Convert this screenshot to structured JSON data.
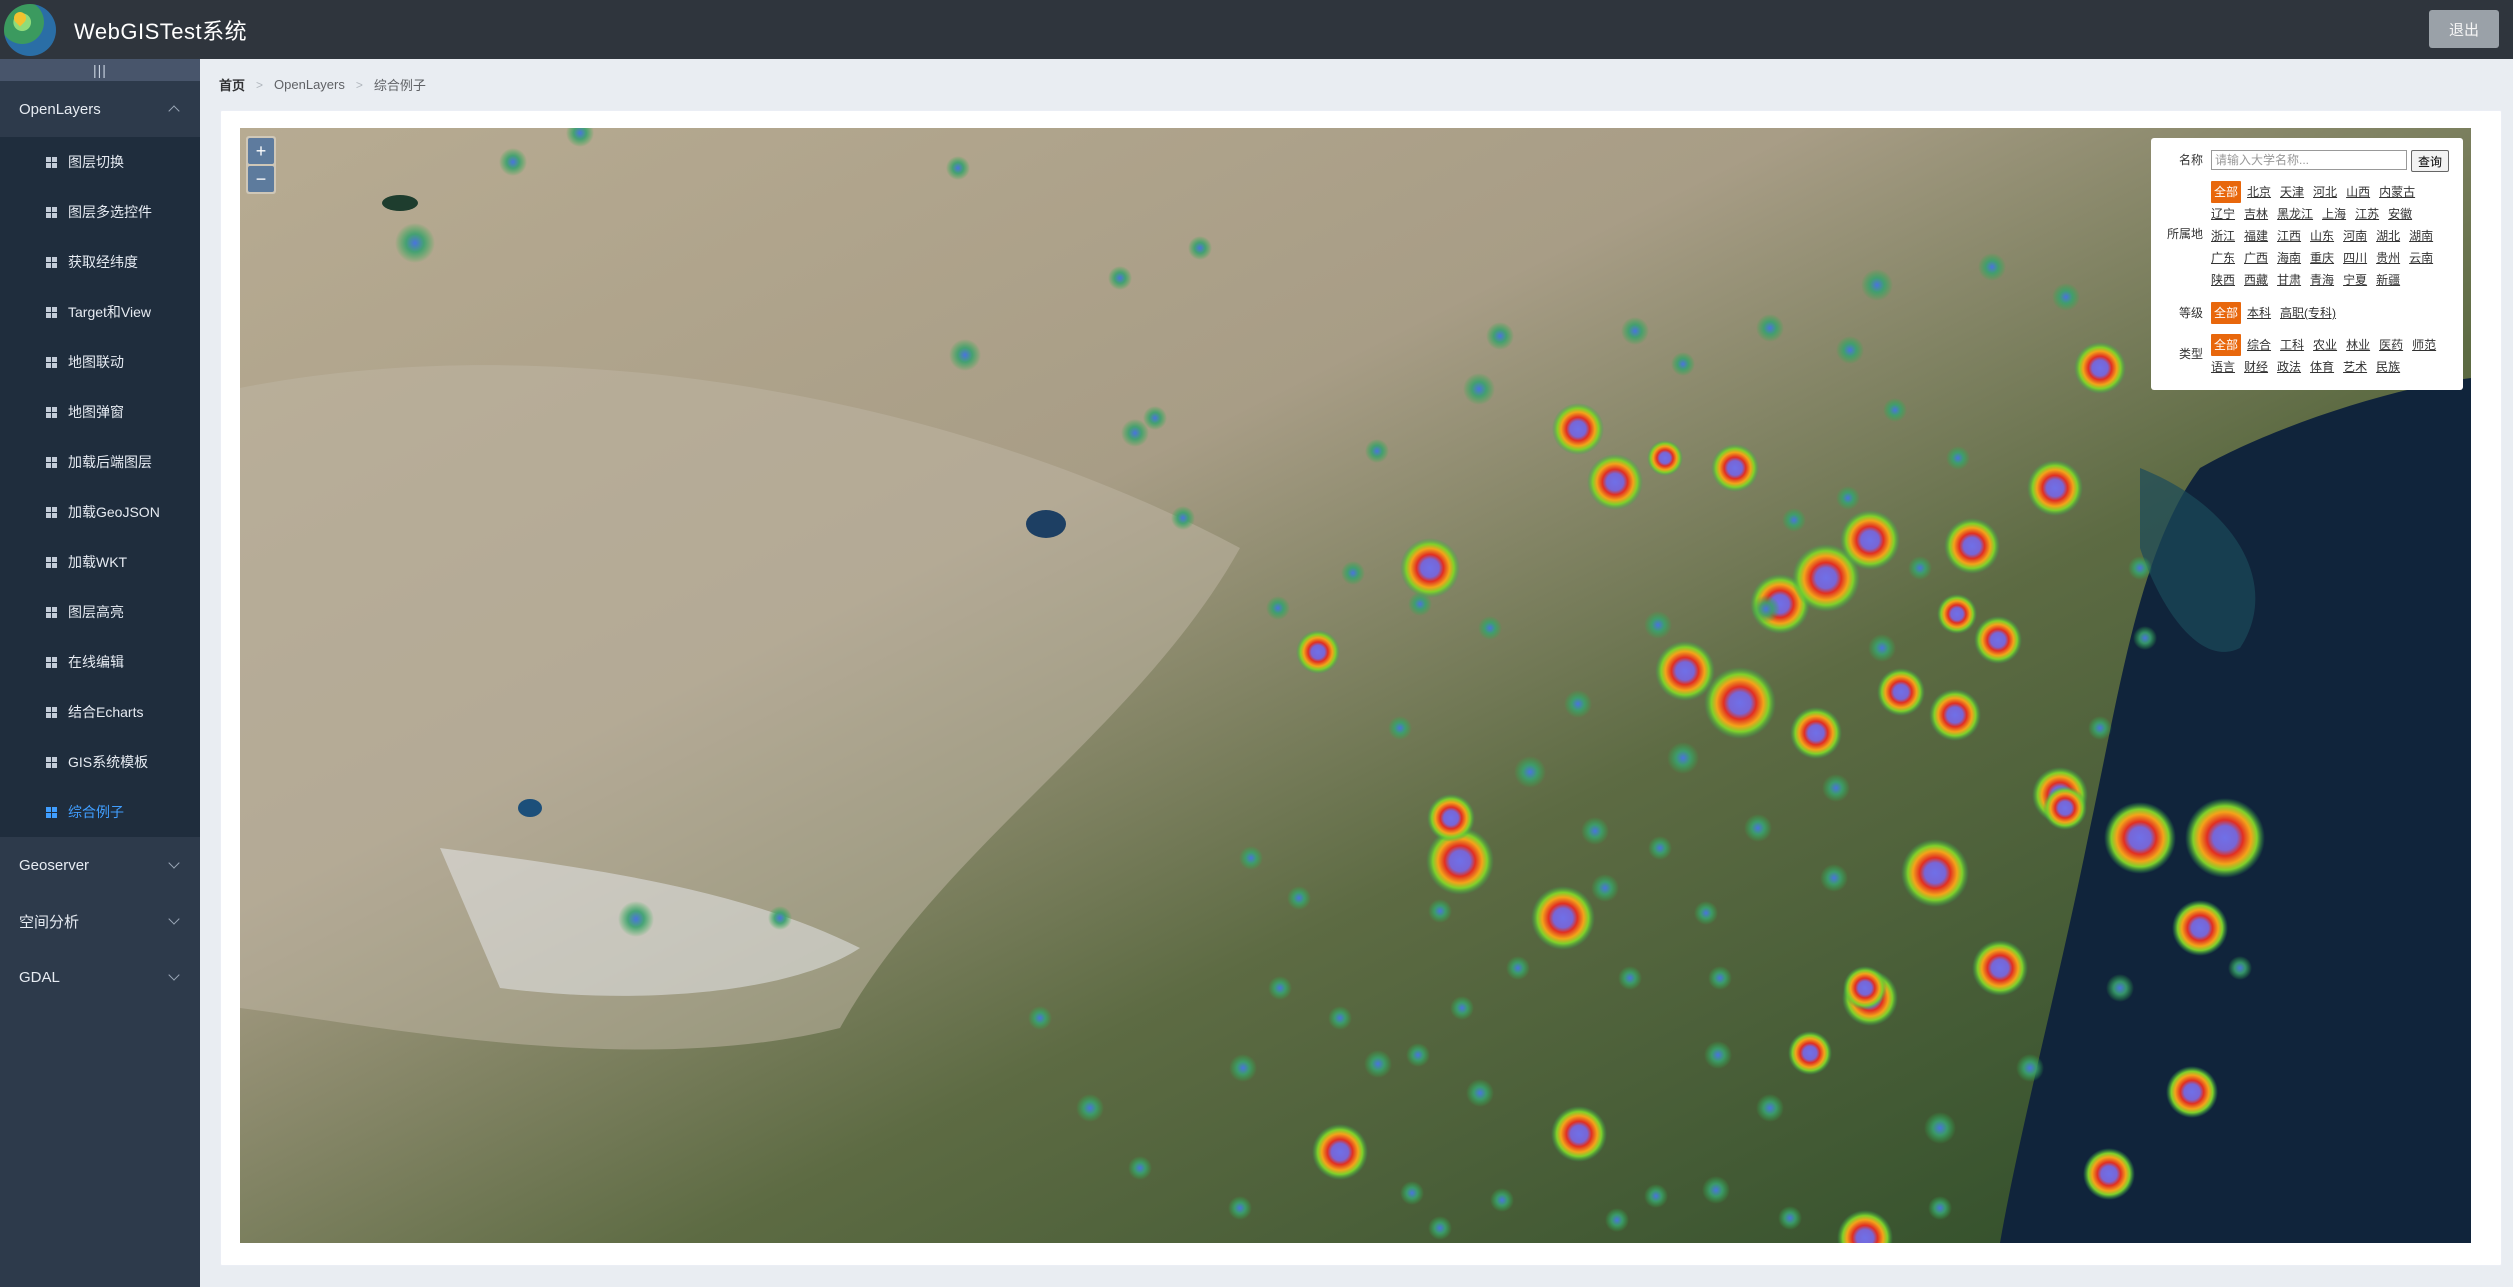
{
  "header": {
    "app_title": "WebGISTest系统",
    "logout_label": "退出"
  },
  "sidebar": {
    "collapse_glyph": "|||",
    "groups": [
      {
        "label": "OpenLayers",
        "expanded": true,
        "items": [
          {
            "label": "图层切换"
          },
          {
            "label": "图层多选控件"
          },
          {
            "label": "获取经纬度"
          },
          {
            "label": "Target和View"
          },
          {
            "label": "地图联动"
          },
          {
            "label": "地图弹窗"
          },
          {
            "label": "加载后端图层"
          },
          {
            "label": "加载GeoJSON"
          },
          {
            "label": "加载WKT"
          },
          {
            "label": "图层高亮"
          },
          {
            "label": "在线编辑"
          },
          {
            "label": "结合Echarts"
          },
          {
            "label": "GIS系统模板"
          },
          {
            "label": "综合例子",
            "active": true
          }
        ]
      },
      {
        "label": "Geoserver",
        "expanded": false
      },
      {
        "label": "空间分析",
        "expanded": false
      },
      {
        "label": "GDAL",
        "expanded": false
      }
    ]
  },
  "breadcrumb": [
    "首页",
    "OpenLayers",
    "综合例子"
  ],
  "map": {
    "zoom_in": "+",
    "zoom_out": "−"
  },
  "filter": {
    "name_label": "名称",
    "search_placeholder": "请输入大学名称...",
    "query_label": "查询",
    "location_label": "所属地",
    "locations": [
      "全部",
      "北京",
      "天津",
      "河北",
      "山西",
      "内蒙古",
      "辽宁",
      "吉林",
      "黑龙江",
      "上海",
      "江苏",
      "安徽",
      "浙江",
      "福建",
      "江西",
      "山东",
      "河南",
      "湖北",
      "湖南",
      "广东",
      "广西",
      "海南",
      "重庆",
      "四川",
      "贵州",
      "云南",
      "陕西",
      "西藏",
      "甘肃",
      "青海",
      "宁夏",
      "新疆"
    ],
    "level_label": "等级",
    "levels": [
      "全部",
      "本科",
      "高职(专科)"
    ],
    "type_label": "类型",
    "types": [
      "全部",
      "综合",
      "工科",
      "农业",
      "林业",
      "医药",
      "师范",
      "语言",
      "财经",
      "政法",
      "体育",
      "艺术",
      "民族"
    ],
    "selected_color": "#e8670c"
  }
}
